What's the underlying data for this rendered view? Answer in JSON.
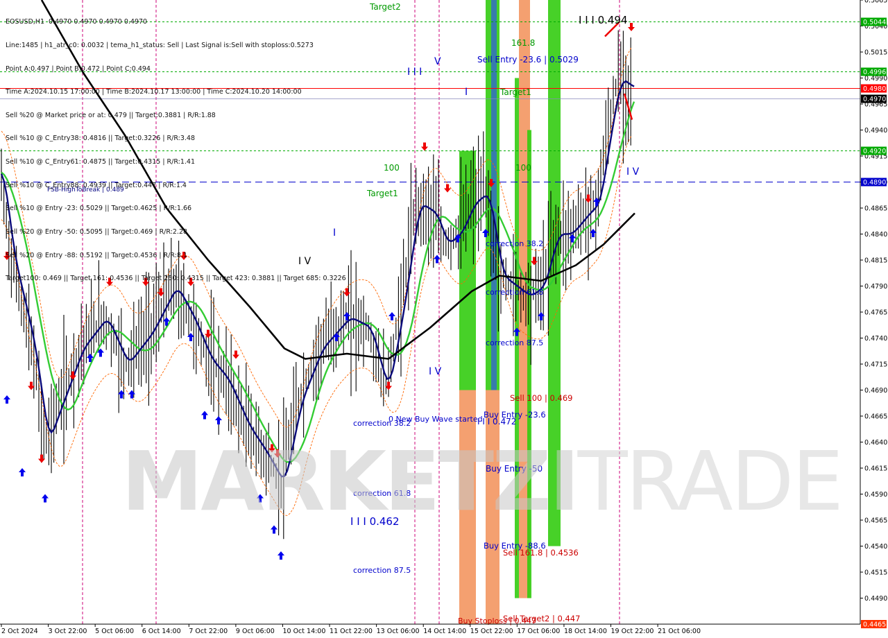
{
  "header": {
    "lines": [
      "EOSUSD,H1  0.4970 0.4970 0.4970 0.4970",
      "Line:1485 | h1_atr_c0: 0.0032 | tema_h1_status: Sell | Last Signal is:Sell with stoploss:0.5273",
      "Point A:0.497 | Point B:0.472 | Point C:0.494",
      "Time A:2024.10.15 17:00:00 | Time B:2024.10.17 13:00:00 | Time C:2024.10.20 14:00:00",
      "Sell %20 @ Market price or at: 0.479 || Target:0.3881 | R/R:1.88",
      "Sell %10 @ C_Entry38: 0.4816 || Target:0.3226 | R/R:3.48",
      "Sell %10 @ C_Entry61: 0.4875 || Target:0.4315 | R/R:1.41",
      "Sell %10 @ C_Entry88: 0.4939 || Target:0.447 | R/R:1.4",
      "Sell %10 @ Entry -23: 0.5029 || Target:0.4625 | R/R:1.66",
      "Sell %20 @ Entry -50: 0.5095 || Target:0.469 | R/R:2.28",
      "Sell %20 @ Entry -88: 0.5192 || Target:0.4536 | R/R:8.1",
      "Target100: 0.469 || Target 161: 0.4536 || Target 250: 0.4315 || Target 423: 0.3881 || Target 685: 0.3226"
    ]
  },
  "watermark": {
    "bold": "MARKETZI",
    "thin": "TRADE"
  },
  "colors": {
    "candle": "#000000",
    "ema_blue": "#0a0a7a",
    "ema_green": "#33cc33",
    "ma_black": "#000000",
    "band_orange": "#ff6600",
    "buy_arrow": "#0000ee",
    "sell_arrow": "#ee0000",
    "green_bar": "#33cc11",
    "orange_bar": "#f08040",
    "blue_bar": "#3366cc",
    "magenta_vline": "#cc0077",
    "level_green": "#009900",
    "level_red": "#ff0000",
    "level_blue": "#0000ff"
  },
  "chart_data": {
    "type": "candlestick",
    "symbol": "EOSUSD",
    "timeframe": "H1",
    "ylim": [
      0.4465,
      0.5065
    ],
    "y_ticks": [
      "0.5065",
      "0.5040",
      "0.5015",
      "0.4990",
      "0.4965",
      "0.4940",
      "0.4915",
      "0.4890",
      "0.4865",
      "0.4840",
      "0.4815",
      "0.4790",
      "0.4765",
      "0.4740",
      "0.4715",
      "0.4690",
      "0.4665",
      "0.4640",
      "0.4615",
      "0.4590",
      "0.4565",
      "0.4540",
      "0.4515",
      "0.4490"
    ],
    "x_ticks": [
      "2 Oct 2024",
      "3 Oct 22:00",
      "5 Oct 06:00",
      "6 Oct 14:00",
      "7 Oct 22:00",
      "9 Oct 06:00",
      "10 Oct 14:00",
      "11 Oct 22:00",
      "13 Oct 06:00",
      "14 Oct 14:00",
      "15 Oct 22:00",
      "17 Oct 06:00",
      "18 Oct 14:00",
      "19 Oct 22:00",
      "21 Oct 06:00"
    ],
    "price_levels": [
      {
        "value": 0.5044,
        "label": "0.5044",
        "color": "#00aa00",
        "style": "dashed"
      },
      {
        "value": 0.4996,
        "label": "0.4996",
        "color": "#00aa00",
        "style": "dashed"
      },
      {
        "value": 0.498,
        "label": "0.4980",
        "color": "#ff0000",
        "style": "solid"
      },
      {
        "value": 0.497,
        "label": "0.4970",
        "color": "#000000",
        "style": "solid"
      },
      {
        "value": 0.492,
        "label": "0.4920",
        "color": "#00aa00",
        "style": "dashed"
      },
      {
        "value": 0.489,
        "label": "0.4890",
        "color": "#0000cc",
        "style": "dashed"
      },
      {
        "value": 0.4465,
        "label": "0.4465",
        "color": "#ff3300",
        "style": "dashed"
      }
    ],
    "annotations": [
      {
        "text": "Target2",
        "color": "#009900"
      },
      {
        "text": "I I I  0.494",
        "color": "#000000"
      },
      {
        "text": "161.8",
        "color": "#009900"
      },
      {
        "text": "Sell Entry -23.6 | 0.5029",
        "color": "#0000cc"
      },
      {
        "text": "I I I",
        "color": "#0000cc"
      },
      {
        "text": "V",
        "color": "#0000cc"
      },
      {
        "text": "I",
        "color": "#0000cc"
      },
      {
        "text": "Target1",
        "color": "#009900"
      },
      {
        "text": "100",
        "color": "#009900"
      },
      {
        "text": "100",
        "color": "#009900"
      },
      {
        "text": "I V",
        "color": "#0000cc"
      },
      {
        "text": "FSB-HighToBreak | 0.489",
        "color": "#000080"
      },
      {
        "text": "Target1",
        "color": "#009900"
      },
      {
        "text": "I",
        "color": "#0000cc"
      },
      {
        "text": "I V",
        "color": "#000000"
      },
      {
        "text": "correction 38.2",
        "color": "#0000cc"
      },
      {
        "text": "correction 61.8",
        "color": "#0000cc"
      },
      {
        "text": "correction 87.5",
        "color": "#0000cc"
      },
      {
        "text": "I V",
        "color": "#0000cc"
      },
      {
        "text": "Sell 100 | 0.469",
        "color": "#cc0000"
      },
      {
        "text": "correction 38.2",
        "color": "#0000cc"
      },
      {
        "text": "0 New Buy Wave started",
        "color": "#0000cc"
      },
      {
        "text": "I I I  0.472",
        "color": "#0000cc"
      },
      {
        "text": "Buy Entry -23.6",
        "color": "#0000cc"
      },
      {
        "text": "Buy Entry -50",
        "color": "#0000cc"
      },
      {
        "text": "correction 61.8",
        "color": "#0000cc"
      },
      {
        "text": "I I I  0.462",
        "color": "#0000cc"
      },
      {
        "text": "Buy Entry -88.6",
        "color": "#0000cc"
      },
      {
        "text": "Sell 161.8 | 0.4536",
        "color": "#cc0000"
      },
      {
        "text": "correction 87.5",
        "color": "#0000cc"
      },
      {
        "text": "Buy Stoploss | 0.447",
        "color": "#cc0000"
      },
      {
        "text": "Sell Target2 | 0.447",
        "color": "#cc0000"
      }
    ]
  }
}
